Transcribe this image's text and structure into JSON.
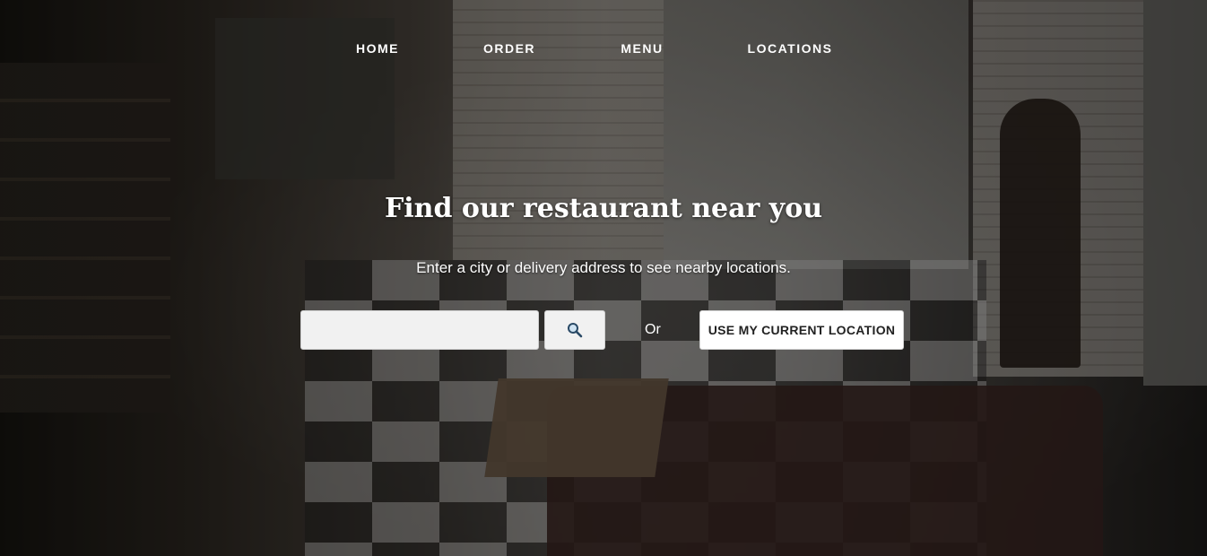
{
  "nav": {
    "items": [
      {
        "label": "HOME"
      },
      {
        "label": "ORDER"
      },
      {
        "label": "MENU"
      },
      {
        "label": "LOCATIONS"
      }
    ]
  },
  "hero": {
    "title": "Find our restaurant near you",
    "subtitle": "Enter a city or delivery address to see nearby locations."
  },
  "search": {
    "value": "",
    "button_icon": "search-icon"
  },
  "or_label": "Or",
  "location_button_label": "USE MY CURRENT LOCATION"
}
